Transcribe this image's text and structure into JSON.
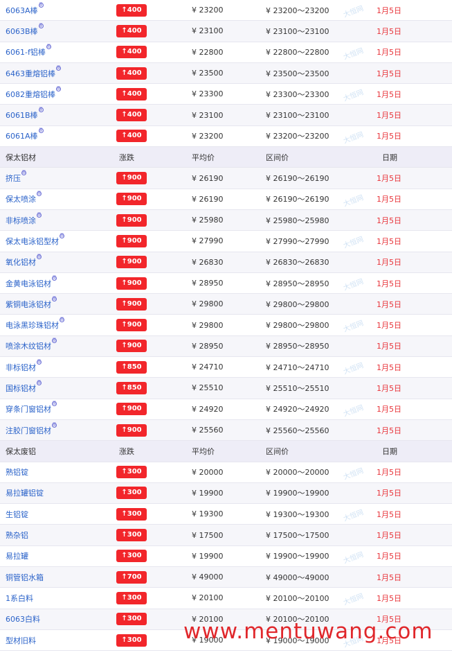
{
  "sections": [
    {
      "header": null,
      "rows": [
        {
          "name": "6063A棒",
          "tag": true,
          "change": "↑400",
          "avg": "¥ 23200",
          "range": "¥ 23200～23200",
          "date": "1月5日"
        },
        {
          "name": "6063B棒",
          "tag": true,
          "change": "↑400",
          "avg": "¥ 23100",
          "range": "¥ 23100～23100",
          "date": "1月5日"
        },
        {
          "name": "6061-f铝棒",
          "tag": true,
          "change": "↑400",
          "avg": "¥ 22800",
          "range": "¥ 22800～22800",
          "date": "1月5日"
        },
        {
          "name": "6463重熔铝棒",
          "tag": true,
          "change": "↑400",
          "avg": "¥ 23500",
          "range": "¥ 23500～23500",
          "date": "1月5日"
        },
        {
          "name": "6082重熔铝棒",
          "tag": true,
          "change": "↑400",
          "avg": "¥ 23300",
          "range": "¥ 23300～23300",
          "date": "1月5日"
        },
        {
          "name": "6061B棒",
          "tag": true,
          "change": "↑400",
          "avg": "¥ 23100",
          "range": "¥ 23100～23100",
          "date": "1月5日"
        },
        {
          "name": "6061A棒",
          "tag": true,
          "change": "↑400",
          "avg": "¥ 23200",
          "range": "¥ 23200～23200",
          "date": "1月5日"
        }
      ]
    },
    {
      "header": {
        "name": "保太铝材",
        "change": "涨跌",
        "avg": "平均价",
        "range": "区间价",
        "date": "日期"
      },
      "rows": [
        {
          "name": "挤压",
          "tag": true,
          "change": "↑900",
          "avg": "¥ 26190",
          "range": "¥ 26190～26190",
          "date": "1月5日"
        },
        {
          "name": "保太喷涂",
          "tag": true,
          "change": "↑900",
          "avg": "¥ 26190",
          "range": "¥ 26190～26190",
          "date": "1月5日"
        },
        {
          "name": "非标喷涂",
          "tag": true,
          "change": "↑900",
          "avg": "¥ 25980",
          "range": "¥ 25980～25980",
          "date": "1月5日"
        },
        {
          "name": "保太电泳铝型材",
          "tag": true,
          "change": "↑900",
          "avg": "¥ 27990",
          "range": "¥ 27990～27990",
          "date": "1月5日"
        },
        {
          "name": "氧化铝材",
          "tag": true,
          "change": "↑900",
          "avg": "¥ 26830",
          "range": "¥ 26830～26830",
          "date": "1月5日"
        },
        {
          "name": "金黄电泳铝材",
          "tag": true,
          "change": "↑900",
          "avg": "¥ 28950",
          "range": "¥ 28950～28950",
          "date": "1月5日"
        },
        {
          "name": "紫铜电泳铝材",
          "tag": true,
          "change": "↑900",
          "avg": "¥ 29800",
          "range": "¥ 29800～29800",
          "date": "1月5日"
        },
        {
          "name": "电泳黑珍珠铝材",
          "tag": true,
          "change": "↑900",
          "avg": "¥ 29800",
          "range": "¥ 29800～29800",
          "date": "1月5日"
        },
        {
          "name": "喷涂木纹铝材",
          "tag": true,
          "change": "↑900",
          "avg": "¥ 28950",
          "range": "¥ 28950～28950",
          "date": "1月5日"
        },
        {
          "name": "非标铝材",
          "tag": true,
          "change": "↑850",
          "avg": "¥ 24710",
          "range": "¥ 24710～24710",
          "date": "1月5日"
        },
        {
          "name": "国标铝材",
          "tag": true,
          "change": "↑850",
          "avg": "¥ 25510",
          "range": "¥ 25510～25510",
          "date": "1月5日"
        },
        {
          "name": "穿条门窗铝材",
          "tag": true,
          "change": "↑900",
          "avg": "¥ 24920",
          "range": "¥ 24920～24920",
          "date": "1月5日"
        },
        {
          "name": "注胶门窗铝材",
          "tag": true,
          "change": "↑900",
          "avg": "¥ 25560",
          "range": "¥ 25560～25560",
          "date": "1月5日"
        }
      ]
    },
    {
      "header": {
        "name": "保太废铝",
        "change": "涨跌",
        "avg": "平均价",
        "range": "区间价",
        "date": "日期"
      },
      "rows": [
        {
          "name": "熟铝锭",
          "tag": false,
          "change": "↑300",
          "avg": "¥ 20000",
          "range": "¥ 20000～20000",
          "date": "1月5日"
        },
        {
          "name": "易拉罐铝锭",
          "tag": false,
          "change": "↑300",
          "avg": "¥ 19900",
          "range": "¥ 19900～19900",
          "date": "1月5日"
        },
        {
          "name": "生铝锭",
          "tag": false,
          "change": "↑300",
          "avg": "¥ 19300",
          "range": "¥ 19300～19300",
          "date": "1月5日"
        },
        {
          "name": "熟杂铝",
          "tag": false,
          "change": "↑300",
          "avg": "¥ 17500",
          "range": "¥ 17500～17500",
          "date": "1月5日"
        },
        {
          "name": "易拉罐",
          "tag": false,
          "change": "↑300",
          "avg": "¥ 19900",
          "range": "¥ 19900～19900",
          "date": "1月5日"
        },
        {
          "name": "铜管铝水箱",
          "tag": false,
          "change": "↑700",
          "avg": "¥ 49000",
          "range": "¥ 49000～49000",
          "date": "1月5日"
        },
        {
          "name": "1系白料",
          "tag": false,
          "change": "↑300",
          "avg": "¥ 20100",
          "range": "¥ 20100～20100",
          "date": "1月5日"
        },
        {
          "name": "6063白料",
          "tag": false,
          "change": "↑300",
          "avg": "¥ 20100",
          "range": "¥ 20100～20100",
          "date": "1月5日"
        },
        {
          "name": "型材旧料",
          "tag": false,
          "change": "↑300",
          "avg": "¥ 19000",
          "range": "¥ 19000～19000",
          "date": "1月5日"
        }
      ]
    }
  ],
  "tag_glyph": "图",
  "watermark_text": "www.mentuwang.com",
  "row_watermark_text": "大恒网"
}
